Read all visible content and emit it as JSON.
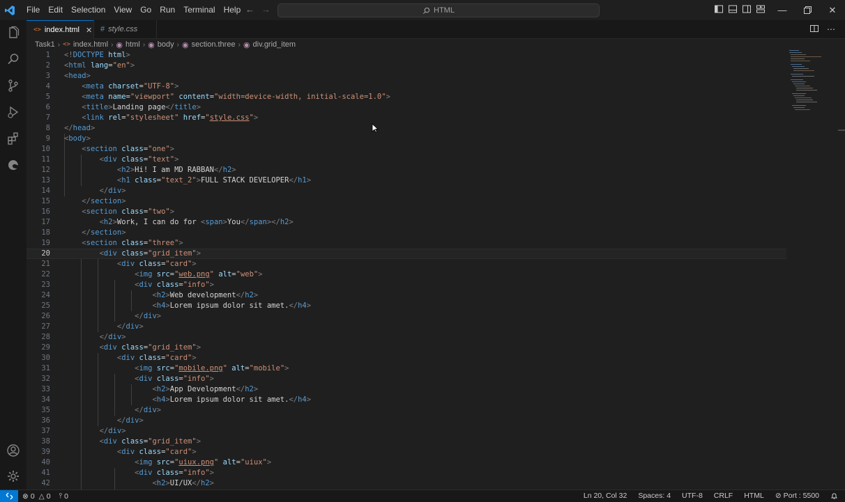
{
  "titlebar": {
    "menu": [
      "File",
      "Edit",
      "Selection",
      "View",
      "Go",
      "Run",
      "Terminal",
      "Help"
    ],
    "search_text": "HTML"
  },
  "tabs": [
    {
      "label": "index.html",
      "icon": "html-file-icon",
      "active": true
    },
    {
      "label": "style.css",
      "icon": "css-file-icon",
      "active": false
    }
  ],
  "breadcrumb": [
    "Task1",
    "index.html",
    "html",
    "body",
    "section.three",
    "div.grid_item"
  ],
  "editor": {
    "current_line": 20,
    "lines": [
      {
        "n": "1"
      },
      {
        "n": "2"
      },
      {
        "n": "3"
      },
      {
        "n": "4"
      },
      {
        "n": "5"
      },
      {
        "n": "6"
      },
      {
        "n": "7"
      },
      {
        "n": "8"
      },
      {
        "n": "9"
      },
      {
        "n": "10"
      },
      {
        "n": "11"
      },
      {
        "n": "12"
      },
      {
        "n": "13"
      },
      {
        "n": "14"
      },
      {
        "n": "15"
      },
      {
        "n": "16"
      },
      {
        "n": "17"
      },
      {
        "n": "18"
      },
      {
        "n": "19"
      },
      {
        "n": "20"
      },
      {
        "n": "21"
      },
      {
        "n": "22"
      },
      {
        "n": "23"
      },
      {
        "n": "24"
      },
      {
        "n": "25"
      },
      {
        "n": "26"
      },
      {
        "n": "27"
      },
      {
        "n": "28"
      },
      {
        "n": "29"
      },
      {
        "n": "30"
      },
      {
        "n": "31"
      },
      {
        "n": "32"
      },
      {
        "n": "33"
      },
      {
        "n": "34"
      },
      {
        "n": "35"
      },
      {
        "n": "36"
      },
      {
        "n": "37"
      },
      {
        "n": "38"
      },
      {
        "n": "39"
      },
      {
        "n": "40"
      },
      {
        "n": "41"
      },
      {
        "n": "42"
      }
    ]
  },
  "statusbar": {
    "errors": "0",
    "warnings": "0",
    "ports": "0",
    "position": "Ln 20, Col 32",
    "spaces": "Spaces: 4",
    "encoding": "UTF-8",
    "eol": "CRLF",
    "language": "HTML",
    "port": "Port : 5500"
  }
}
